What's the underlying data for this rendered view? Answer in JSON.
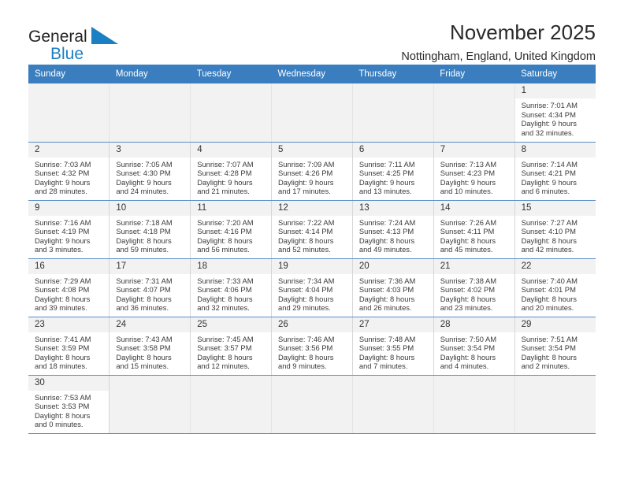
{
  "brand": {
    "line1": "General",
    "line2": "Blue",
    "triangle_color": "#1b7fc3",
    "text_color": "#232323"
  },
  "header": {
    "title": "November 2025",
    "subtitle": "Nottingham, England, United Kingdom"
  },
  "theme": {
    "header_row_bg": "#3a7ebf",
    "header_row_text": "#ffffff",
    "daynum_bg": "#f2f2f2",
    "row_divider": "#5a8fc4"
  },
  "weekdays": [
    "Sunday",
    "Monday",
    "Tuesday",
    "Wednesday",
    "Thursday",
    "Friday",
    "Saturday"
  ],
  "labels": {
    "sunrise_prefix": "Sunrise:",
    "sunset_prefix": "Sunset:",
    "daylight_prefix": "Daylight:"
  },
  "weeks": [
    [
      {
        "empty": true
      },
      {
        "empty": true
      },
      {
        "empty": true
      },
      {
        "empty": true
      },
      {
        "empty": true
      },
      {
        "empty": true
      },
      {
        "day": "1",
        "sunrise": "Sunrise: 7:01 AM",
        "sunset": "Sunset: 4:34 PM",
        "daylight1": "Daylight: 9 hours",
        "daylight2": "and 32 minutes."
      }
    ],
    [
      {
        "day": "2",
        "sunrise": "Sunrise: 7:03 AM",
        "sunset": "Sunset: 4:32 PM",
        "daylight1": "Daylight: 9 hours",
        "daylight2": "and 28 minutes."
      },
      {
        "day": "3",
        "sunrise": "Sunrise: 7:05 AM",
        "sunset": "Sunset: 4:30 PM",
        "daylight1": "Daylight: 9 hours",
        "daylight2": "and 24 minutes."
      },
      {
        "day": "4",
        "sunrise": "Sunrise: 7:07 AM",
        "sunset": "Sunset: 4:28 PM",
        "daylight1": "Daylight: 9 hours",
        "daylight2": "and 21 minutes."
      },
      {
        "day": "5",
        "sunrise": "Sunrise: 7:09 AM",
        "sunset": "Sunset: 4:26 PM",
        "daylight1": "Daylight: 9 hours",
        "daylight2": "and 17 minutes."
      },
      {
        "day": "6",
        "sunrise": "Sunrise: 7:11 AM",
        "sunset": "Sunset: 4:25 PM",
        "daylight1": "Daylight: 9 hours",
        "daylight2": "and 13 minutes."
      },
      {
        "day": "7",
        "sunrise": "Sunrise: 7:13 AM",
        "sunset": "Sunset: 4:23 PM",
        "daylight1": "Daylight: 9 hours",
        "daylight2": "and 10 minutes."
      },
      {
        "day": "8",
        "sunrise": "Sunrise: 7:14 AM",
        "sunset": "Sunset: 4:21 PM",
        "daylight1": "Daylight: 9 hours",
        "daylight2": "and 6 minutes."
      }
    ],
    [
      {
        "day": "9",
        "sunrise": "Sunrise: 7:16 AM",
        "sunset": "Sunset: 4:19 PM",
        "daylight1": "Daylight: 9 hours",
        "daylight2": "and 3 minutes."
      },
      {
        "day": "10",
        "sunrise": "Sunrise: 7:18 AM",
        "sunset": "Sunset: 4:18 PM",
        "daylight1": "Daylight: 8 hours",
        "daylight2": "and 59 minutes."
      },
      {
        "day": "11",
        "sunrise": "Sunrise: 7:20 AM",
        "sunset": "Sunset: 4:16 PM",
        "daylight1": "Daylight: 8 hours",
        "daylight2": "and 56 minutes."
      },
      {
        "day": "12",
        "sunrise": "Sunrise: 7:22 AM",
        "sunset": "Sunset: 4:14 PM",
        "daylight1": "Daylight: 8 hours",
        "daylight2": "and 52 minutes."
      },
      {
        "day": "13",
        "sunrise": "Sunrise: 7:24 AM",
        "sunset": "Sunset: 4:13 PM",
        "daylight1": "Daylight: 8 hours",
        "daylight2": "and 49 minutes."
      },
      {
        "day": "14",
        "sunrise": "Sunrise: 7:26 AM",
        "sunset": "Sunset: 4:11 PM",
        "daylight1": "Daylight: 8 hours",
        "daylight2": "and 45 minutes."
      },
      {
        "day": "15",
        "sunrise": "Sunrise: 7:27 AM",
        "sunset": "Sunset: 4:10 PM",
        "daylight1": "Daylight: 8 hours",
        "daylight2": "and 42 minutes."
      }
    ],
    [
      {
        "day": "16",
        "sunrise": "Sunrise: 7:29 AM",
        "sunset": "Sunset: 4:08 PM",
        "daylight1": "Daylight: 8 hours",
        "daylight2": "and 39 minutes."
      },
      {
        "day": "17",
        "sunrise": "Sunrise: 7:31 AM",
        "sunset": "Sunset: 4:07 PM",
        "daylight1": "Daylight: 8 hours",
        "daylight2": "and 36 minutes."
      },
      {
        "day": "18",
        "sunrise": "Sunrise: 7:33 AM",
        "sunset": "Sunset: 4:06 PM",
        "daylight1": "Daylight: 8 hours",
        "daylight2": "and 32 minutes."
      },
      {
        "day": "19",
        "sunrise": "Sunrise: 7:34 AM",
        "sunset": "Sunset: 4:04 PM",
        "daylight1": "Daylight: 8 hours",
        "daylight2": "and 29 minutes."
      },
      {
        "day": "20",
        "sunrise": "Sunrise: 7:36 AM",
        "sunset": "Sunset: 4:03 PM",
        "daylight1": "Daylight: 8 hours",
        "daylight2": "and 26 minutes."
      },
      {
        "day": "21",
        "sunrise": "Sunrise: 7:38 AM",
        "sunset": "Sunset: 4:02 PM",
        "daylight1": "Daylight: 8 hours",
        "daylight2": "and 23 minutes."
      },
      {
        "day": "22",
        "sunrise": "Sunrise: 7:40 AM",
        "sunset": "Sunset: 4:01 PM",
        "daylight1": "Daylight: 8 hours",
        "daylight2": "and 20 minutes."
      }
    ],
    [
      {
        "day": "23",
        "sunrise": "Sunrise: 7:41 AM",
        "sunset": "Sunset: 3:59 PM",
        "daylight1": "Daylight: 8 hours",
        "daylight2": "and 18 minutes."
      },
      {
        "day": "24",
        "sunrise": "Sunrise: 7:43 AM",
        "sunset": "Sunset: 3:58 PM",
        "daylight1": "Daylight: 8 hours",
        "daylight2": "and 15 minutes."
      },
      {
        "day": "25",
        "sunrise": "Sunrise: 7:45 AM",
        "sunset": "Sunset: 3:57 PM",
        "daylight1": "Daylight: 8 hours",
        "daylight2": "and 12 minutes."
      },
      {
        "day": "26",
        "sunrise": "Sunrise: 7:46 AM",
        "sunset": "Sunset: 3:56 PM",
        "daylight1": "Daylight: 8 hours",
        "daylight2": "and 9 minutes."
      },
      {
        "day": "27",
        "sunrise": "Sunrise: 7:48 AM",
        "sunset": "Sunset: 3:55 PM",
        "daylight1": "Daylight: 8 hours",
        "daylight2": "and 7 minutes."
      },
      {
        "day": "28",
        "sunrise": "Sunrise: 7:50 AM",
        "sunset": "Sunset: 3:54 PM",
        "daylight1": "Daylight: 8 hours",
        "daylight2": "and 4 minutes."
      },
      {
        "day": "29",
        "sunrise": "Sunrise: 7:51 AM",
        "sunset": "Sunset: 3:54 PM",
        "daylight1": "Daylight: 8 hours",
        "daylight2": "and 2 minutes."
      }
    ],
    [
      {
        "day": "30",
        "sunrise": "Sunrise: 7:53 AM",
        "sunset": "Sunset: 3:53 PM",
        "daylight1": "Daylight: 8 hours",
        "daylight2": "and 0 minutes."
      },
      {
        "empty": true
      },
      {
        "empty": true
      },
      {
        "empty": true
      },
      {
        "empty": true
      },
      {
        "empty": true
      },
      {
        "empty": true
      }
    ]
  ]
}
